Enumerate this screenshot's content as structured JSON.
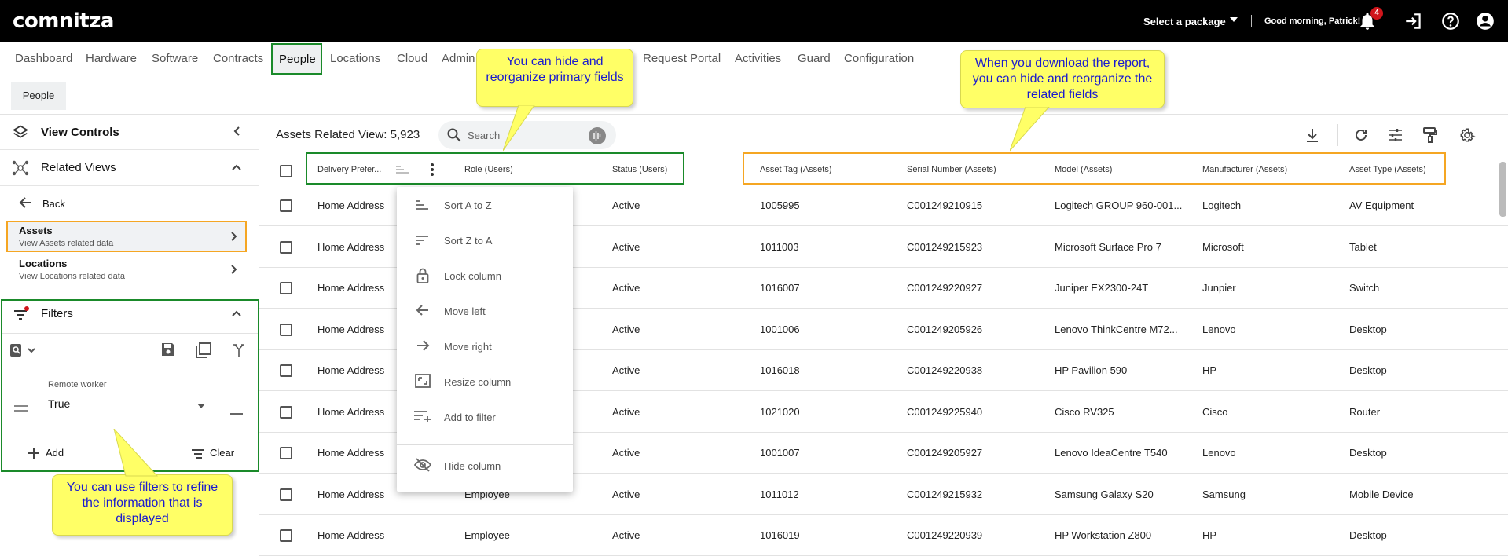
{
  "app": {
    "logo": "comnitza"
  },
  "topbar": {
    "package": "Select a package",
    "greeting": "Good morning, Patrick!",
    "notification_count": "4"
  },
  "mainnav": {
    "items": [
      "Dashboard",
      "Hardware",
      "Software",
      "Contracts",
      "People",
      "Locations",
      "Cloud",
      "Admin",
      "Request Portal",
      "Activities",
      "Guard",
      "Configuration"
    ],
    "active": "People"
  },
  "subnav": {
    "tab": "People"
  },
  "sidebar": {
    "view_controls": "View Controls",
    "related_views": "Related Views",
    "back": "Back",
    "items": [
      {
        "title": "Assets",
        "subtitle": "View Assets related data"
      },
      {
        "title": "Locations",
        "subtitle": "View Locations related data"
      }
    ],
    "filters": "Filters",
    "filter": {
      "label": "Remote worker",
      "value": "True"
    },
    "add": "Add",
    "clear": "Clear"
  },
  "content": {
    "title": "Assets Related View: 5,923",
    "search_placeholder": "Search"
  },
  "table": {
    "columns": [
      "Delivery Prefer...",
      "Role (Users)",
      "Status (Users)",
      "Asset Tag (Assets)",
      "Serial Number (Assets)",
      "Model (Assets)",
      "Manufacturer (Assets)",
      "Asset Type (Assets)"
    ],
    "rows": [
      [
        "Home Address",
        "",
        "Active",
        "1005995",
        "C001249210915",
        "Logitech GROUP 960-001...",
        "Logitech",
        "AV Equipment"
      ],
      [
        "Home Address",
        "",
        "Active",
        "1011003",
        "C001249215923",
        "Microsoft Surface Pro 7",
        "Microsoft",
        "Tablet"
      ],
      [
        "Home Address",
        "",
        "Active",
        "1016007",
        "C001249220927",
        "Juniper EX2300-24T",
        "Junpier",
        "Switch"
      ],
      [
        "Home Address",
        "",
        "Active",
        "1001006",
        "C001249205926",
        "Lenovo ThinkCentre M72...",
        "Lenovo",
        "Desktop"
      ],
      [
        "Home Address",
        "",
        "Active",
        "1016018",
        "C001249220938",
        "HP Pavilion 590",
        "HP",
        "Desktop"
      ],
      [
        "Home Address",
        "",
        "Active",
        "1021020",
        "C001249225940",
        "Cisco RV325",
        "Cisco",
        "Router"
      ],
      [
        "Home Address",
        "",
        "Active",
        "1001007",
        "C001249205927",
        "Lenovo IdeaCentre T540",
        "Lenovo",
        "Desktop"
      ],
      [
        "Home Address",
        "Employee",
        "Active",
        "1011012",
        "C001249215932",
        "Samsung Galaxy S20",
        "Samsung",
        "Mobile Device"
      ],
      [
        "Home Address",
        "Employee",
        "Active",
        "1016019",
        "C001249220939",
        "HP Workstation Z800",
        "HP",
        "Desktop"
      ]
    ]
  },
  "column_menu": {
    "items": [
      "Sort A to Z",
      "Sort Z to A",
      "Lock column",
      "Move left",
      "Move right",
      "Resize column",
      "Add to filter",
      "Hide column"
    ]
  },
  "callouts": {
    "primary": "You can hide and reorganize primary fields",
    "related": "When you download the report, you can hide and reorganize the related fields",
    "filters": "You can use filters to refine the information that is displayed"
  },
  "colors": {
    "accent_green": "#1a8a2a",
    "accent_orange": "#f5a623",
    "callout_yellow": "#ffff66",
    "badge_red": "#d0161c"
  }
}
